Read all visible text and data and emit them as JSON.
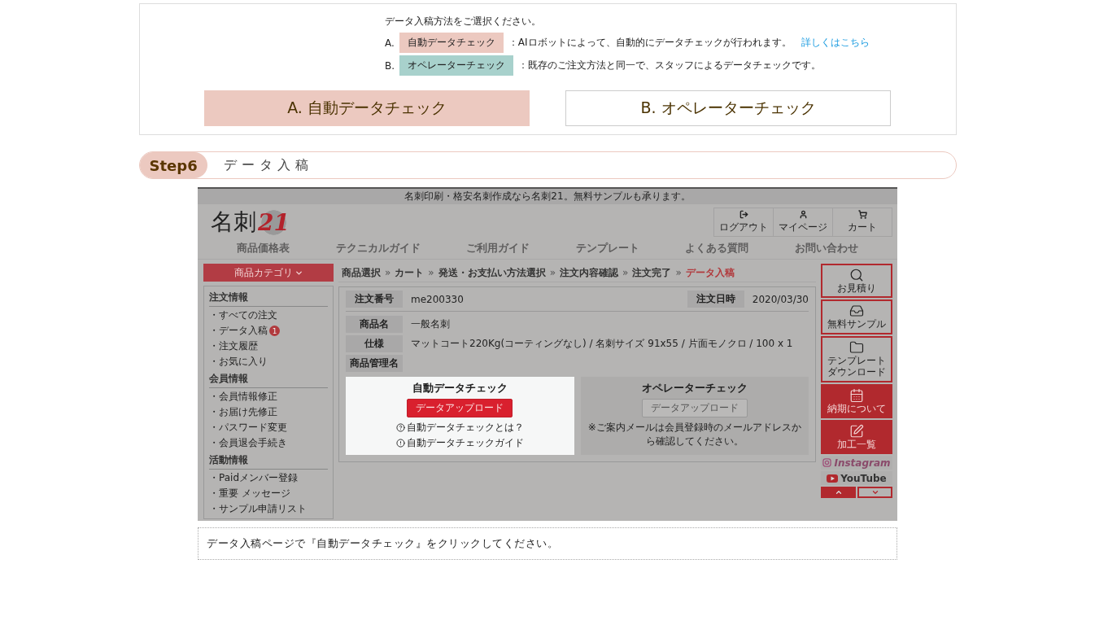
{
  "intro": {
    "heading": "データ入稿方法をご選択ください。",
    "options": [
      {
        "letter": "A.",
        "tag": "自動データチェック",
        "color": "#ecc9c0",
        "description": "：AIロボットによって、自動的にデータチェックが行われます。",
        "link": "詳しくはこちら"
      },
      {
        "letter": "B.",
        "tag": "オペレーターチェック",
        "color": "#a8d1cc",
        "description": "：既存のご注文方法と同一で、スタッフによるデータチェックです。"
      }
    ],
    "choices": [
      {
        "label": "A. 自動データチェック",
        "selected": true
      },
      {
        "label": "B. オペレーターチェック",
        "selected": false
      }
    ]
  },
  "step": {
    "badge": "Step6",
    "title": "データ入稿"
  },
  "screenshot": {
    "announcement": "名刺印刷・格安名刺作成なら名刺21。無料サンプルも承ります。",
    "logo": {
      "text": "名刺",
      "number": "21"
    },
    "header_buttons": [
      {
        "label": "ログアウト"
      },
      {
        "label": "マイページ"
      },
      {
        "label": "カート"
      }
    ],
    "nav": [
      "商品価格表",
      "テクニカルガイド",
      "ご利用ガイド",
      "テンプレート",
      "よくある質問",
      "お問い合わせ"
    ],
    "category_button": "商品カテゴリ",
    "breadcrumb": [
      {
        "label": "商品選択",
        "selected": false
      },
      {
        "label": "カート",
        "selected": false
      },
      {
        "label": "発送・お支払い方法選択",
        "selected": false
      },
      {
        "label": "注文内容確認",
        "selected": false
      },
      {
        "label": "注文完了",
        "selected": false
      },
      {
        "label": "データ入稿",
        "selected": true
      }
    ],
    "separator": "»",
    "sidebar": [
      {
        "heading": "注文情報",
        "items": [
          {
            "label": "・すべての注文"
          },
          {
            "label": "・データ入稿",
            "badge": "1"
          },
          {
            "label": "・注文履歴"
          },
          {
            "label": "・お気に入り"
          }
        ]
      },
      {
        "heading": "会員情報",
        "items": [
          {
            "label": "・会員情報修正"
          },
          {
            "label": "・お届け先修正"
          },
          {
            "label": "・パスワード変更"
          },
          {
            "label": "・会員退会手続き"
          }
        ]
      },
      {
        "heading": "活動情報",
        "items": [
          {
            "label": "・Paidメンバー登録"
          },
          {
            "label": "・重要 メッセージ"
          },
          {
            "label": "・サンプル申請リスト"
          }
        ]
      }
    ],
    "order": {
      "number_label": "注文番号",
      "number": "me200330",
      "date_label": "注文日時",
      "date": "2020/03/30",
      "rows": [
        {
          "label": "商品名",
          "value": "一般名刺"
        },
        {
          "label": "仕様",
          "value": "マットコート220Kg(コーティングなし) / 名刺サイズ 91x55 / 片面モノクロ / 100 x 1"
        },
        {
          "label": "商品管理名"
        }
      ]
    },
    "panels": [
      {
        "title": "自動データチェック",
        "button": "データアップロード",
        "selected": true,
        "links": [
          {
            "label": "自動データチェックとは？"
          },
          {
            "label": "自動データチェックガイド"
          }
        ]
      },
      {
        "title": "オペレーターチェック",
        "button": "データアップロード",
        "selected": false,
        "note": "※ご案内メールは会員登録時のメールアドレスから確認してください。"
      }
    ],
    "rail": [
      {
        "kind": "outline",
        "lines": [
          "お見積り"
        ]
      },
      {
        "kind": "outline",
        "lines": [
          "無料サンプル"
        ]
      },
      {
        "kind": "outline",
        "lines": [
          "テンプレート",
          "ダウンロード"
        ]
      },
      {
        "kind": "filled",
        "lines": [
          "納期について"
        ]
      },
      {
        "kind": "filled",
        "lines": [
          "加工一覧"
        ]
      }
    ],
    "social": [
      {
        "kind": "instagram",
        "label": "Instagram"
      },
      {
        "kind": "youtube",
        "label": "YouTube"
      }
    ]
  },
  "caption": "データ入稿ページで『自動データチェック』をクリックしてください。"
}
